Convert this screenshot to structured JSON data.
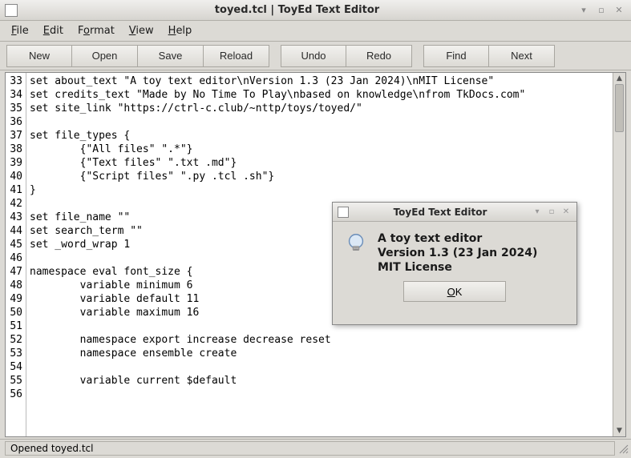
{
  "window": {
    "title": "toyed.tcl | ToyEd Text Editor"
  },
  "menubar": {
    "items": [
      {
        "label": "File",
        "mnemonic_index": 0
      },
      {
        "label": "Edit",
        "mnemonic_index": 0
      },
      {
        "label": "Format",
        "mnemonic_index": 1
      },
      {
        "label": "View",
        "mnemonic_index": 0
      },
      {
        "label": "Help",
        "mnemonic_index": 0
      }
    ]
  },
  "toolbar": {
    "groups": [
      [
        "New",
        "Open",
        "Save",
        "Reload"
      ],
      [
        "Undo",
        "Redo"
      ],
      [
        "Find",
        "Next"
      ]
    ]
  },
  "editor": {
    "first_line_number": 33,
    "lines": [
      "set about_text \"A toy text editor\\nVersion 1.3 (23 Jan 2024)\\nMIT License\"",
      "set credits_text \"Made by No Time To Play\\nbased on knowledge\\nfrom TkDocs.com\"",
      "set site_link \"https://ctrl-c.club/~nttp/toys/toyed/\"",
      "",
      "set file_types {",
      "        {\"All files\" \".*\"}",
      "        {\"Text files\" \".txt .md\"}",
      "        {\"Script files\" \".py .tcl .sh\"}",
      "}",
      "",
      "set file_name \"\"",
      "set search_term \"\"",
      "set _word_wrap 1",
      "",
      "namespace eval font_size {",
      "        variable minimum 6",
      "        variable default 11",
      "        variable maximum 16",
      "",
      "        namespace export increase decrease reset",
      "        namespace ensemble create",
      "",
      "        variable current $default",
      ""
    ]
  },
  "statusbar": {
    "text": "Opened toyed.tcl"
  },
  "dialog": {
    "title": "ToyEd Text Editor",
    "lines": [
      "A toy text editor",
      "Version 1.3 (23 Jan 2024)",
      "MIT License"
    ],
    "ok_label": "OK"
  }
}
